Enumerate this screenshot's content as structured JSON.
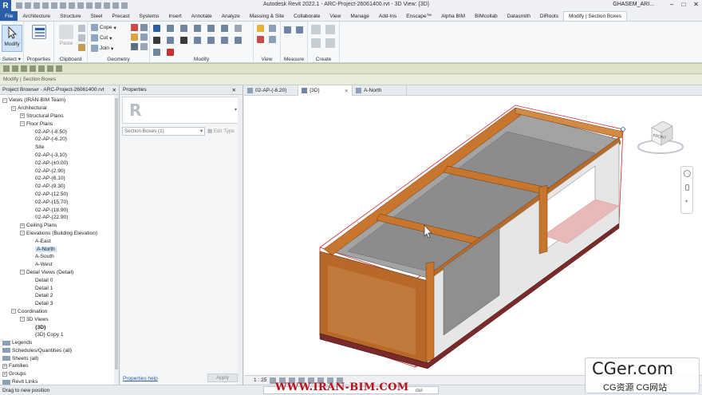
{
  "app": {
    "logo": "R",
    "title": "Autodesk Revit 2022.1 - ARC-Project-26061400.rvt - 3D View: {3D}",
    "user": "GHASEM_ARI...",
    "window_buttons": [
      "–",
      "□",
      "✕"
    ]
  },
  "ribbon_tabs": [
    "File",
    "Architecture",
    "Structure",
    "Steel",
    "Precast",
    "Systems",
    "Insert",
    "Annotate",
    "Analyze",
    "Massing & Site",
    "Collaborate",
    "View",
    "Manage",
    "Add-Ins",
    "Enscape™",
    "Alpha BIM",
    "BIMcollab",
    "Datasmith",
    "DiRoots",
    "Modify | Section Boxes"
  ],
  "ribbon": {
    "modify_label": "Modify",
    "select_label": "Select",
    "properties_label": "Properties",
    "clipboard_label": "Clipboard",
    "paste_label": "Paste",
    "cope_label": "Cope",
    "cut_label": "Cut",
    "join_label": "Join",
    "geometry_label": "Geometry",
    "modify_panel_label": "Modify",
    "view_label": "View",
    "measure_label": "Measure",
    "create_label": "Create"
  },
  "context_bar": {
    "label": "Modify | Section Boxes"
  },
  "project_browser": {
    "header": "Project Browser - ARC-Project-26061400.rvt",
    "close": "✕",
    "nodes": [
      {
        "text": "Views (IRAN-BIM Team)",
        "level": 0,
        "exp": "−"
      },
      {
        "text": "Architectural",
        "level": 1,
        "exp": "−"
      },
      {
        "text": "Structural Plans",
        "level": 2,
        "exp": "+"
      },
      {
        "text": "Floor Plans",
        "level": 2,
        "exp": "−"
      },
      {
        "text": "02-AP-(-8.50)",
        "level": 3,
        "exp": ""
      },
      {
        "text": "02-AP-(-6.20)",
        "level": 3,
        "exp": ""
      },
      {
        "text": "Site",
        "level": 3,
        "exp": ""
      },
      {
        "text": "02-AP-(-3.10)",
        "level": 3,
        "exp": ""
      },
      {
        "text": "02-AP-(±0.00)",
        "level": 3,
        "exp": ""
      },
      {
        "text": "02-AP-(2.90)",
        "level": 3,
        "exp": ""
      },
      {
        "text": "02-AP-(6.10)",
        "level": 3,
        "exp": ""
      },
      {
        "text": "02-AP-(9.30)",
        "level": 3,
        "exp": ""
      },
      {
        "text": "02-AP-(12.50)",
        "level": 3,
        "exp": ""
      },
      {
        "text": "02-AP-(15.70)",
        "level": 3,
        "exp": ""
      },
      {
        "text": "02-AP-(18.90)",
        "level": 3,
        "exp": ""
      },
      {
        "text": "02-AP-(22.90)",
        "level": 3,
        "exp": ""
      },
      {
        "text": "Ceiling Plans",
        "level": 2,
        "exp": "+"
      },
      {
        "text": "Elevations (Building Elevation)",
        "level": 2,
        "exp": "−"
      },
      {
        "text": "A-East",
        "level": 3,
        "exp": ""
      },
      {
        "text": "A-North",
        "level": 3,
        "exp": "",
        "selected": true
      },
      {
        "text": "A-South",
        "level": 3,
        "exp": ""
      },
      {
        "text": "A-West",
        "level": 3,
        "exp": ""
      },
      {
        "text": "Detail Views (Detail)",
        "level": 2,
        "exp": "−"
      },
      {
        "text": "Detail 0",
        "level": 3,
        "exp": ""
      },
      {
        "text": "Detail 1",
        "level": 3,
        "exp": ""
      },
      {
        "text": "Detail 2",
        "level": 3,
        "exp": ""
      },
      {
        "text": "Detail 3",
        "level": 3,
        "exp": ""
      },
      {
        "text": "Coordination",
        "level": 1,
        "exp": "−"
      },
      {
        "text": "3D Views",
        "level": 2,
        "exp": "−"
      },
      {
        "text": "{3D}",
        "level": 3,
        "exp": "",
        "bold": true
      },
      {
        "text": "{3D} Copy 1",
        "level": 3,
        "exp": ""
      },
      {
        "text": "Legends",
        "level": 0,
        "exp": ""
      },
      {
        "text": "Schedules/Quantities (all)",
        "level": 0,
        "exp": ""
      },
      {
        "text": "Sheets (all)",
        "level": 0,
        "exp": ""
      },
      {
        "text": "Families",
        "level": 0,
        "exp": "+"
      },
      {
        "text": "Groups",
        "level": 0,
        "exp": "+"
      },
      {
        "text": "Revit Links",
        "level": 0,
        "exp": ""
      }
    ]
  },
  "properties": {
    "header": "Properties",
    "close": "✕",
    "type_logo": "R",
    "selector": "Section Boxes (1)",
    "edit_type": "Edit Type",
    "help_link": "Properties help",
    "apply": "Apply"
  },
  "view_tabs": [
    {
      "label": "02-AP-(-6.20)",
      "active": false
    },
    {
      "label": "{3D}",
      "active": true
    },
    {
      "label": "A-North",
      "active": false
    }
  ],
  "view_bar": {
    "scale": "1 : 25"
  },
  "status": {
    "text": "Drag to new position",
    "combo_value": "del"
  },
  "viewcube": {
    "face": "FRONT"
  },
  "watermarks": {
    "site": "WWW.IRAN-BIM.COM",
    "cger": "CGer.com",
    "cger_sub": "CG资源 CG网站"
  },
  "colors": {
    "revit_blue": "#2a5fa6",
    "context_green": "#dde3c9",
    "wood_orange": "#c8762e",
    "slab_gray": "#9b9b9b",
    "section_red": "#d12a2a"
  }
}
